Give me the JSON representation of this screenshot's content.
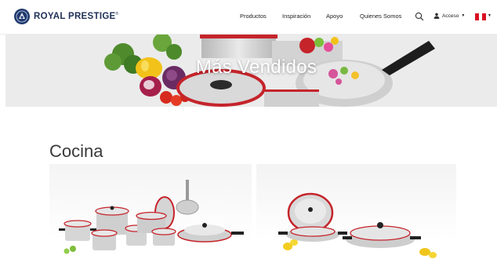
{
  "brand": {
    "name": "ROYAL PRESTIGE",
    "mark": "®"
  },
  "nav": {
    "items": [
      "Productos",
      "Inspiración",
      "Apoyo",
      "Quienes Somos"
    ],
    "account_label": "Acceso"
  },
  "icons": {
    "search": "search-icon",
    "user": "user-icon",
    "flag": "peru-flag-icon"
  },
  "colors": {
    "brand_navy": "#1d2f57",
    "flag_red": "#d91023"
  },
  "hero": {
    "title": "Más Vendidos"
  },
  "section": {
    "title": "Cocina"
  }
}
